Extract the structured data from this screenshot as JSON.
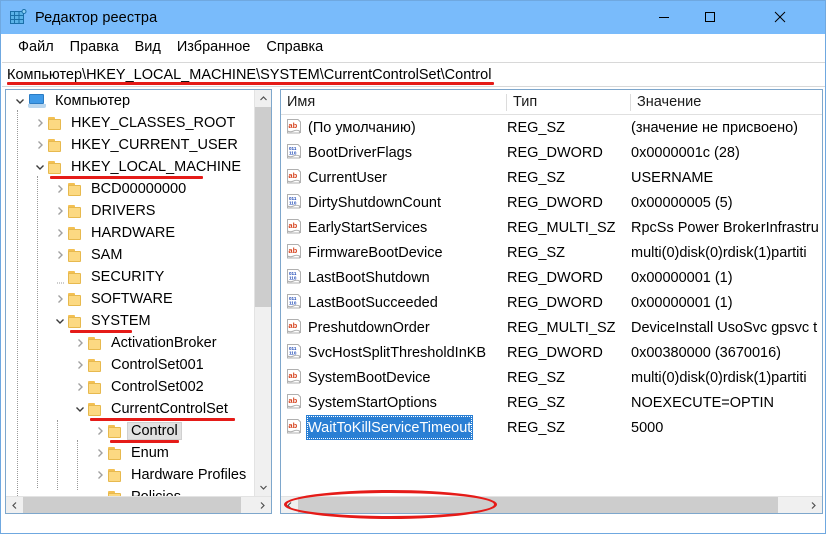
{
  "window": {
    "title": "Редактор реестра",
    "icon": "registry-editor-icon",
    "titlebar_color": "#79bbfb",
    "controls": {
      "minimize": "minimize-icon",
      "maximize": "maximize-icon",
      "close": "close-icon"
    }
  },
  "menubar": {
    "items": [
      {
        "label": "Файл"
      },
      {
        "label": "Правка"
      },
      {
        "label": "Вид"
      },
      {
        "label": "Избранное"
      },
      {
        "label": "Справка"
      }
    ]
  },
  "address": {
    "value": "Компьютер\\HKEY_LOCAL_MACHINE\\SYSTEM\\CurrentControlSet\\Control",
    "annotation_color": "#e51b18"
  },
  "tree": {
    "nodes": [
      {
        "label": "Компьютер",
        "depth": 0,
        "chevron": "expanded",
        "icon": "computer-icon",
        "selected": false,
        "underlined": false
      },
      {
        "label": "HKEY_CLASSES_ROOT",
        "depth": 1,
        "chevron": "collapsed",
        "icon": "folder-icon",
        "selected": false,
        "underlined": false
      },
      {
        "label": "HKEY_CURRENT_USER",
        "depth": 1,
        "chevron": "collapsed",
        "icon": "folder-icon",
        "selected": false,
        "underlined": false
      },
      {
        "label": "HKEY_LOCAL_MACHINE",
        "depth": 1,
        "chevron": "expanded",
        "icon": "folder-icon",
        "selected": false,
        "underlined": true
      },
      {
        "label": "BCD00000000",
        "depth": 2,
        "chevron": "collapsed",
        "icon": "folder-icon",
        "selected": false,
        "underlined": false
      },
      {
        "label": "DRIVERS",
        "depth": 2,
        "chevron": "collapsed",
        "icon": "folder-icon",
        "selected": false,
        "underlined": false
      },
      {
        "label": "HARDWARE",
        "depth": 2,
        "chevron": "collapsed",
        "icon": "folder-icon",
        "selected": false,
        "underlined": false
      },
      {
        "label": "SAM",
        "depth": 2,
        "chevron": "collapsed",
        "icon": "folder-icon",
        "selected": false,
        "underlined": false
      },
      {
        "label": "SECURITY",
        "depth": 2,
        "chevron": "none",
        "icon": "folder-icon",
        "selected": false,
        "underlined": false
      },
      {
        "label": "SOFTWARE",
        "depth": 2,
        "chevron": "collapsed",
        "icon": "folder-icon",
        "selected": false,
        "underlined": false
      },
      {
        "label": "SYSTEM",
        "depth": 2,
        "chevron": "expanded",
        "icon": "folder-icon",
        "selected": false,
        "underlined": true
      },
      {
        "label": "ActivationBroker",
        "depth": 3,
        "chevron": "collapsed",
        "icon": "folder-icon",
        "selected": false,
        "underlined": false
      },
      {
        "label": "ControlSet001",
        "depth": 3,
        "chevron": "collapsed",
        "icon": "folder-icon",
        "selected": false,
        "underlined": false
      },
      {
        "label": "ControlSet002",
        "depth": 3,
        "chevron": "collapsed",
        "icon": "folder-icon",
        "selected": false,
        "underlined": false
      },
      {
        "label": "CurrentControlSet",
        "depth": 3,
        "chevron": "expanded",
        "icon": "folder-icon",
        "selected": false,
        "underlined": true
      },
      {
        "label": "Control",
        "depth": 4,
        "chevron": "collapsed",
        "icon": "folder-icon",
        "selected": true,
        "underlined": true
      },
      {
        "label": "Enum",
        "depth": 4,
        "chevron": "collapsed",
        "icon": "folder-icon",
        "selected": false,
        "underlined": false
      },
      {
        "label": "Hardware Profiles",
        "depth": 4,
        "chevron": "collapsed",
        "icon": "folder-icon",
        "selected": false,
        "underlined": false
      },
      {
        "label": "Policies",
        "depth": 4,
        "chevron": "none",
        "icon": "folder-icon",
        "selected": false,
        "underlined": false
      }
    ]
  },
  "list": {
    "columns": [
      {
        "label": "Имя"
      },
      {
        "label": "Тип"
      },
      {
        "label": "Значение"
      }
    ],
    "rows": [
      {
        "name": "(По умолчанию)",
        "type": "REG_SZ",
        "value": "(значение не присвоено)",
        "icon": "string-value-icon",
        "selected": false
      },
      {
        "name": "BootDriverFlags",
        "type": "REG_DWORD",
        "value": "0x0000001c (28)",
        "icon": "dword-value-icon",
        "selected": false
      },
      {
        "name": "CurrentUser",
        "type": "REG_SZ",
        "value": "USERNAME",
        "icon": "string-value-icon",
        "selected": false
      },
      {
        "name": "DirtyShutdownCount",
        "type": "REG_DWORD",
        "value": "0x00000005 (5)",
        "icon": "dword-value-icon",
        "selected": false
      },
      {
        "name": "EarlyStartServices",
        "type": "REG_MULTI_SZ",
        "value": "RpcSs Power BrokerInfrastru",
        "icon": "string-value-icon",
        "selected": false
      },
      {
        "name": "FirmwareBootDevice",
        "type": "REG_SZ",
        "value": "multi(0)disk(0)rdisk(1)partiti",
        "icon": "string-value-icon",
        "selected": false
      },
      {
        "name": "LastBootShutdown",
        "type": "REG_DWORD",
        "value": "0x00000001 (1)",
        "icon": "dword-value-icon",
        "selected": false
      },
      {
        "name": "LastBootSucceeded",
        "type": "REG_DWORD",
        "value": "0x00000001 (1)",
        "icon": "dword-value-icon",
        "selected": false
      },
      {
        "name": "PreshutdownOrder",
        "type": "REG_MULTI_SZ",
        "value": "DeviceInstall UsoSvc gpsvc t",
        "icon": "string-value-icon",
        "selected": false
      },
      {
        "name": "SvcHostSplitThresholdInKB",
        "type": "REG_DWORD",
        "value": "0x00380000 (3670016)",
        "icon": "dword-value-icon",
        "selected": false
      },
      {
        "name": "SystemBootDevice",
        "type": "REG_SZ",
        "value": "multi(0)disk(0)rdisk(1)partiti",
        "icon": "string-value-icon",
        "selected": false
      },
      {
        "name": "SystemStartOptions",
        "type": "REG_SZ",
        "value": " NOEXECUTE=OPTIN",
        "icon": "string-value-icon",
        "selected": false
      },
      {
        "name": "WaitToKillServiceTimeout",
        "type": "REG_SZ",
        "value": "5000",
        "icon": "string-value-icon",
        "selected": true
      }
    ]
  },
  "scrollbars": {
    "tree_vertical": "tree-vertical-scrollbar",
    "tree_horizontal": "tree-horizontal-scrollbar",
    "list_horizontal": "list-horizontal-scrollbar"
  },
  "annotations": {
    "highlight_color": "#e51b18",
    "selection_color": "#2a7fd4"
  }
}
